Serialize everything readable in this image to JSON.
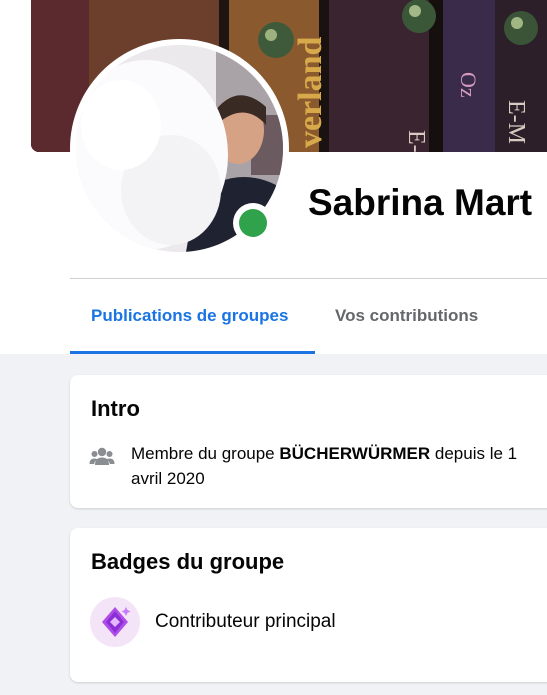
{
  "profile": {
    "name": "Sabrina Mart",
    "online": true
  },
  "cover": {
    "book_titles": [
      "verland",
      "E-M",
      "Oz",
      "E-M"
    ]
  },
  "tabs": [
    {
      "label": "Publications de groupes",
      "active": true
    },
    {
      "label": "Vos contributions",
      "active": false
    }
  ],
  "intro": {
    "title": "Intro",
    "icon": "people-icon",
    "prefix": "Membre du groupe ",
    "group": "BÜCHERWÜRMER",
    "suffix": " depuis le 1 avril 2020"
  },
  "badges": {
    "title": "Badges du groupe",
    "items": [
      {
        "label": "Contributeur principal",
        "icon": "sparkle-badge-icon"
      }
    ]
  },
  "colors": {
    "accent": "#1b74e4",
    "online": "#31a24c",
    "muted_text": "#65676b",
    "page_bg": "#f0f2f5"
  }
}
